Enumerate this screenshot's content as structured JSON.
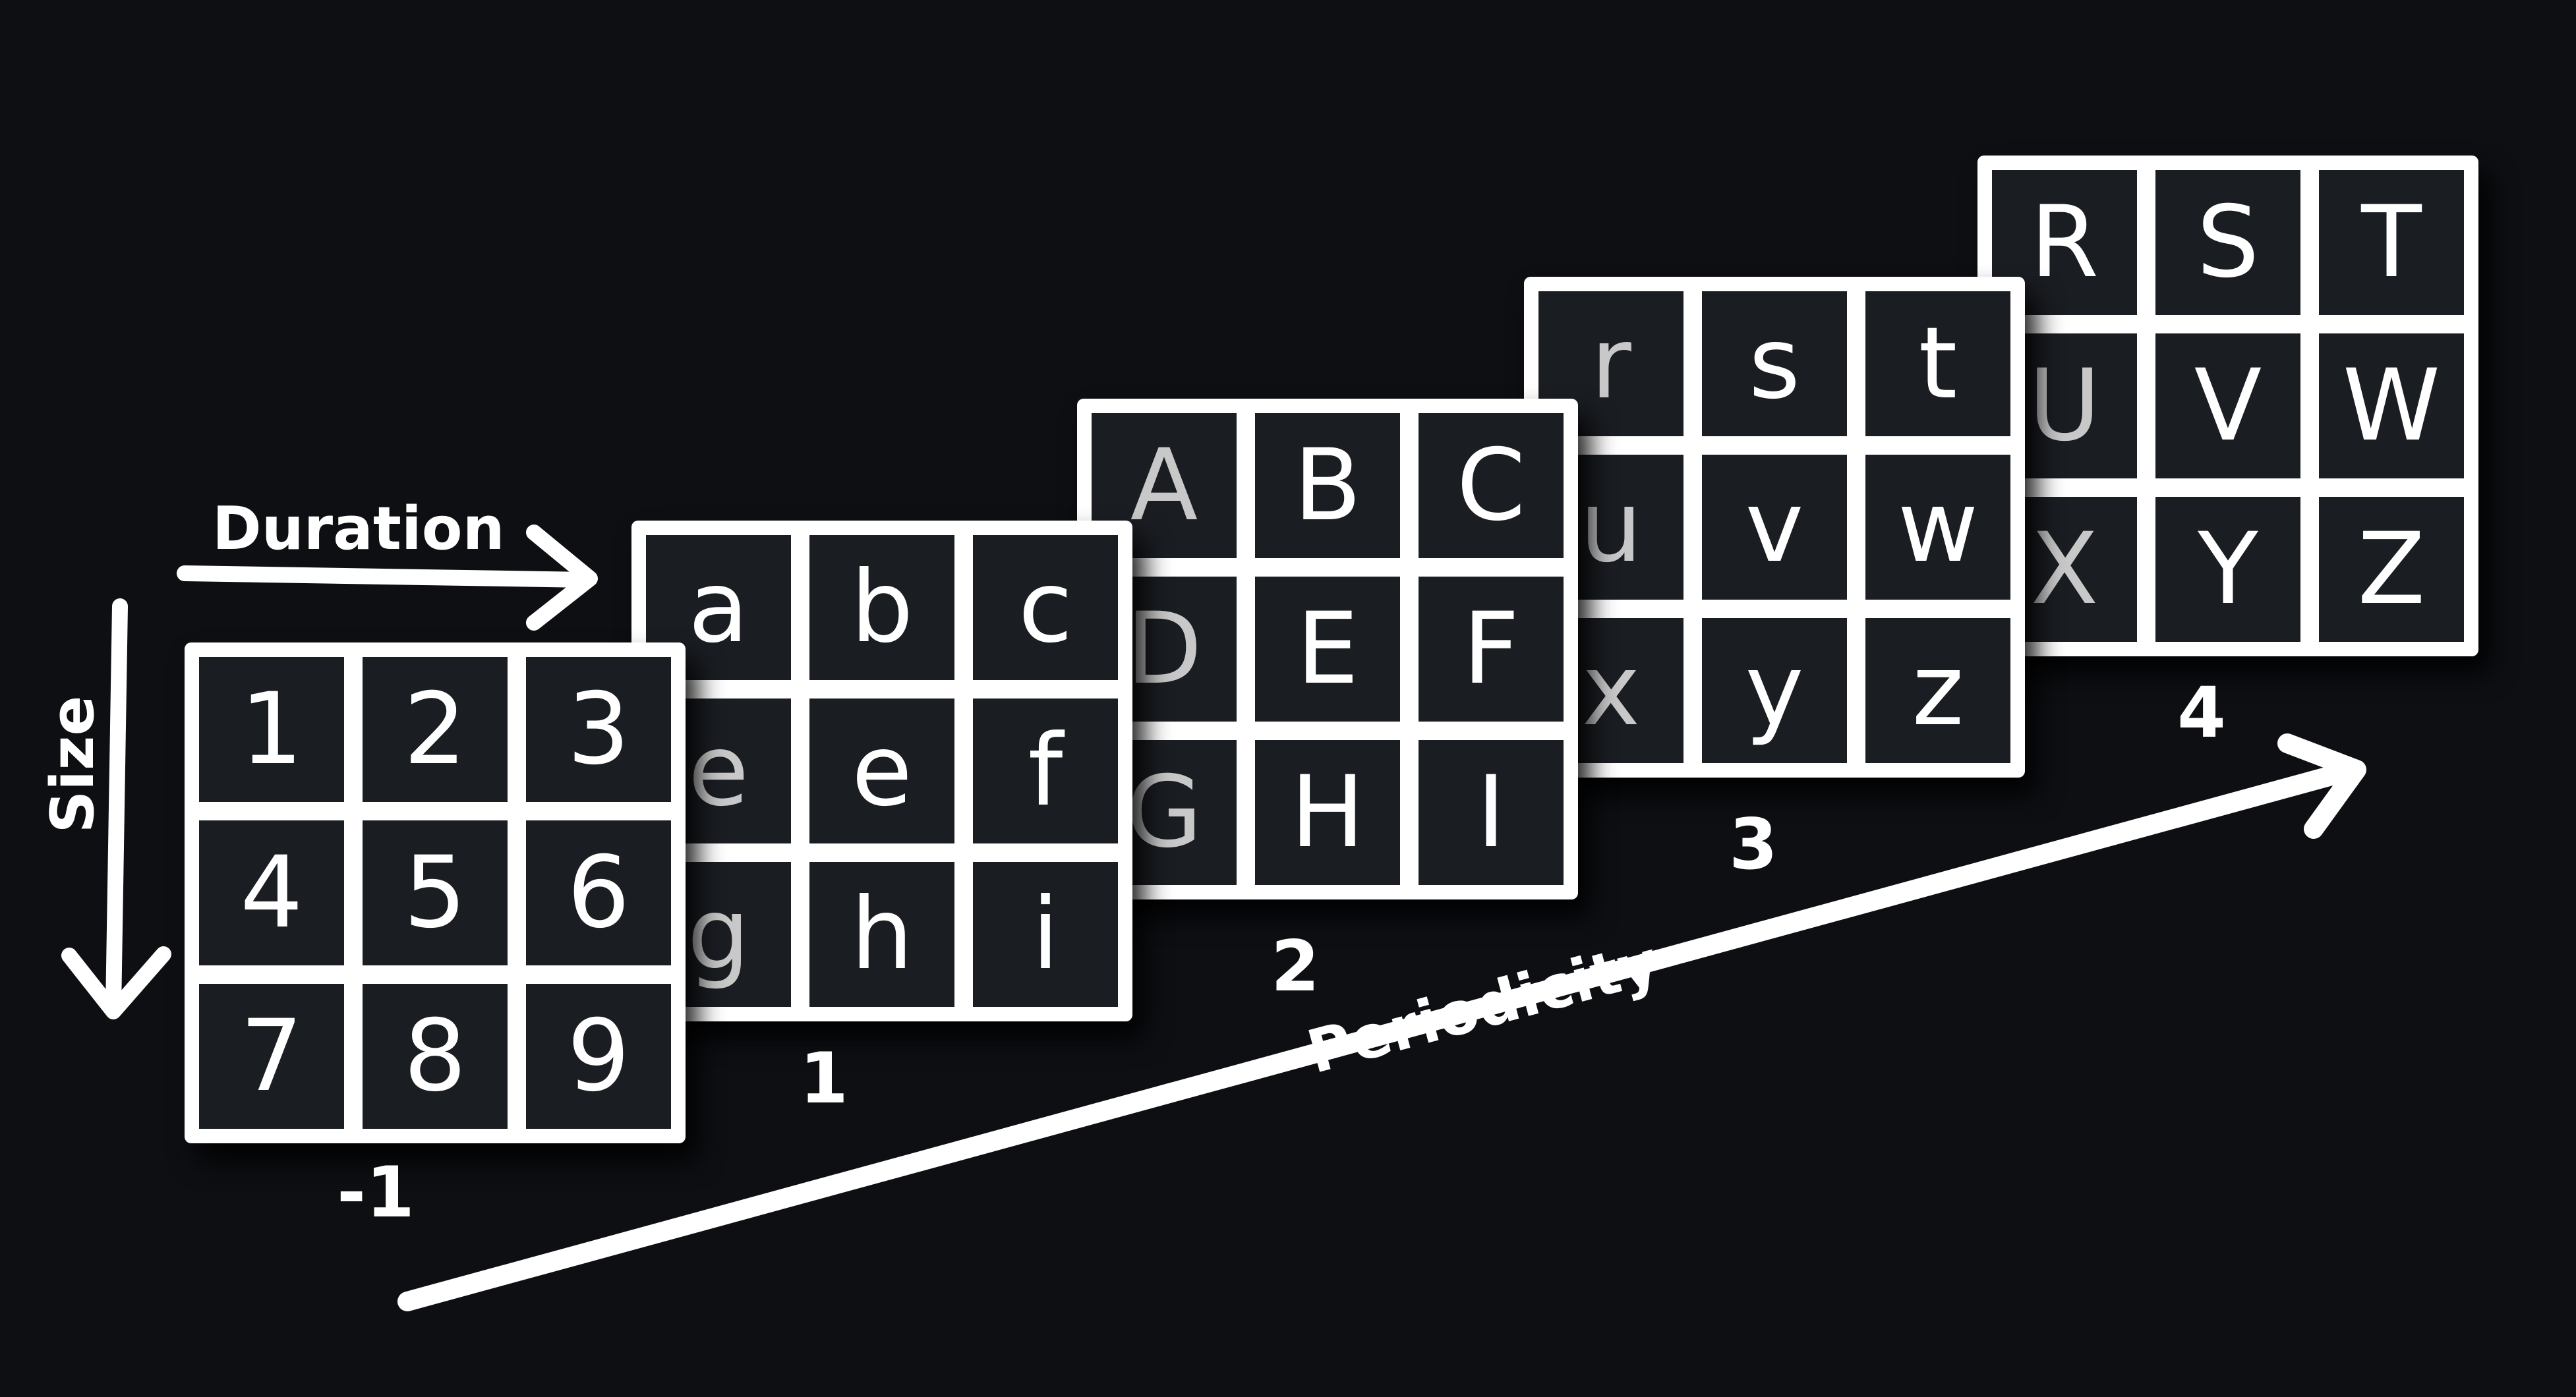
{
  "axes": {
    "duration": "Duration",
    "size": "Size",
    "periodicity": "Periodicity"
  },
  "panels": [
    {
      "label": "-1",
      "cells": [
        "1",
        "2",
        "3",
        "4",
        "5",
        "6",
        "7",
        "8",
        "9"
      ]
    },
    {
      "label": "1",
      "cells": [
        "a",
        "b",
        "c",
        "e",
        "e",
        "f",
        "g",
        "h",
        "i"
      ]
    },
    {
      "label": "2",
      "cells": [
        "A",
        "B",
        "C",
        "D",
        "E",
        "F",
        "G",
        "H",
        "I"
      ]
    },
    {
      "label": "3",
      "cells": [
        "r",
        "s",
        "t",
        "u",
        "v",
        "w",
        "x",
        "y",
        "z"
      ]
    },
    {
      "label": "4",
      "cells": [
        "R",
        "S",
        "T",
        "U",
        "V",
        "W",
        "X",
        "Y",
        "Z"
      ]
    }
  ],
  "colors": {
    "background": "#0d0f13",
    "cell": "#1a1d22",
    "frame": "#ffffff"
  }
}
